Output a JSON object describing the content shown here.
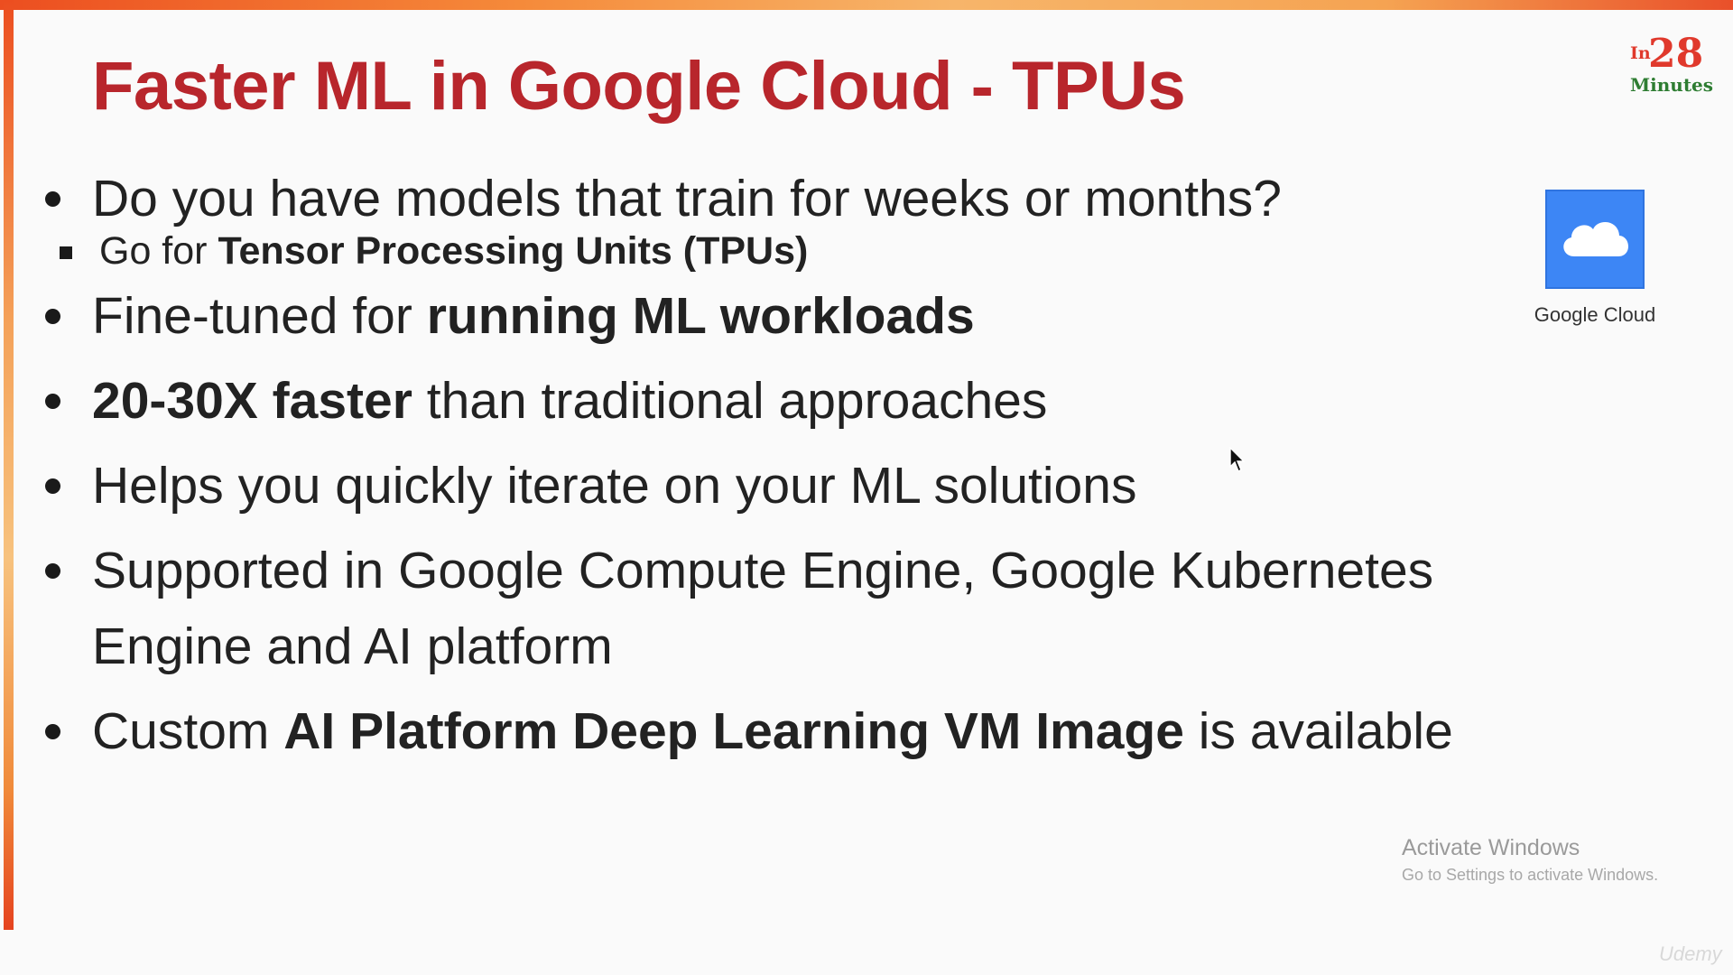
{
  "slide": {
    "title": "Faster ML in Google Cloud - TPUs",
    "logo": {
      "prefix": "In",
      "number": "28",
      "suffix": "Minutes"
    },
    "bullets": [
      {
        "segments": [
          {
            "text": "Do you have models that train for weeks or months?",
            "bold": false
          }
        ]
      },
      {
        "sub": true,
        "segments": [
          {
            "text": "Go for ",
            "bold": false
          },
          {
            "text": "Tensor Processing Units (TPUs)",
            "bold": true
          }
        ]
      },
      {
        "segments": [
          {
            "text": "Fine-tuned for ",
            "bold": false
          },
          {
            "text": "running ML workloads",
            "bold": true
          }
        ]
      },
      {
        "segments": [
          {
            "text": "20-30X faster",
            "bold": true
          },
          {
            "text": " than traditional approaches",
            "bold": false
          }
        ]
      },
      {
        "segments": [
          {
            "text": "Helps you quickly iterate on your ML solutions",
            "bold": false
          }
        ]
      },
      {
        "segments": [
          {
            "text": "Supported in Google Compute Engine, Google Kubernetes Engine and AI platform",
            "bold": false
          }
        ]
      },
      {
        "segments": [
          {
            "text": "Custom ",
            "bold": false
          },
          {
            "text": "AI Platform Deep Learning VM Image",
            "bold": true
          },
          {
            "text": " is available",
            "bold": false
          }
        ]
      }
    ],
    "google_cloud": {
      "label": "Google Cloud",
      "icon": "cloud-icon",
      "color": "#3d86f5"
    },
    "accent_color": "#b8262c"
  },
  "overlay": {
    "activate_title": "Activate Windows",
    "activate_subtitle": "Go to Settings to activate Windows.",
    "watermark": "Udemy"
  }
}
